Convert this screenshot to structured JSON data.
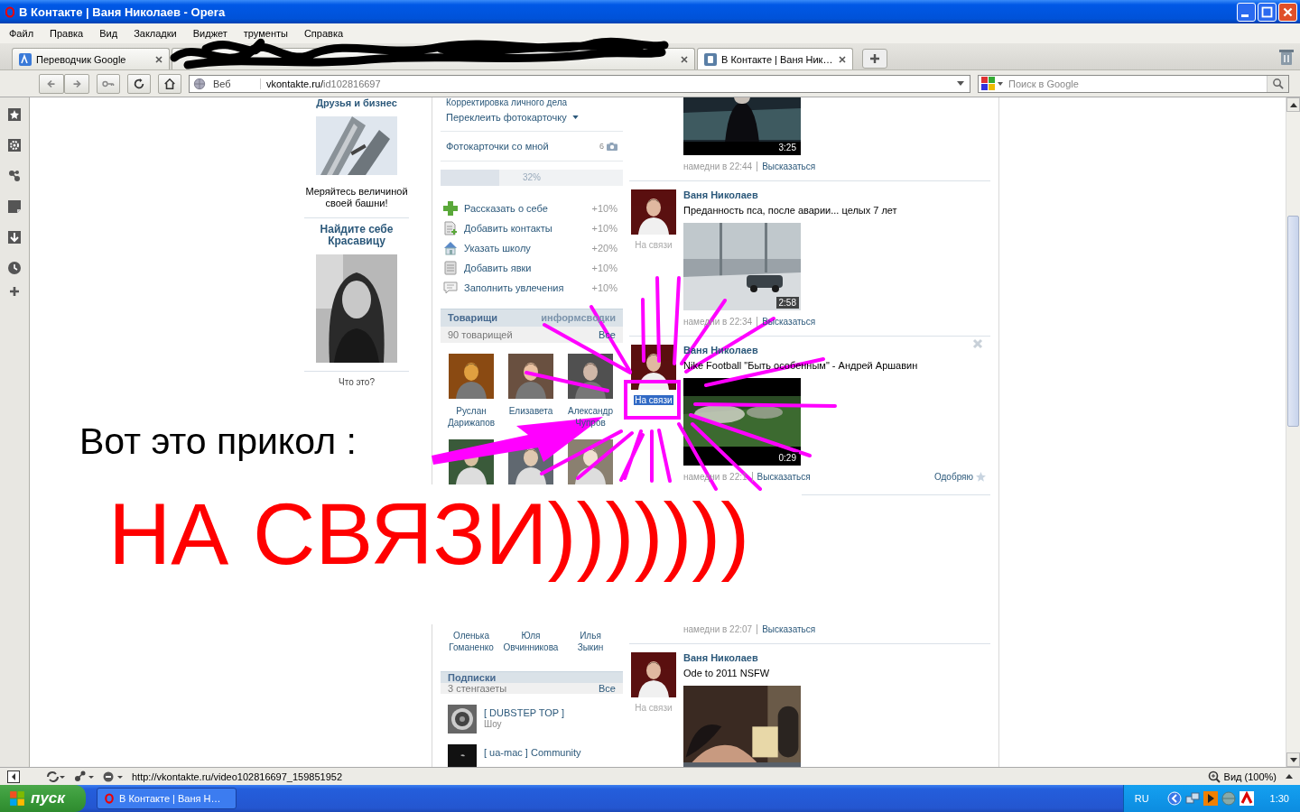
{
  "window": {
    "title": "В Контакте | Ваня Николаев - Opera"
  },
  "menu": [
    "Файл",
    "Правка",
    "Вид",
    "Закладки",
    "Виджет",
    "трументы",
    "Справка"
  ],
  "tabs": [
    {
      "title": "Переводчик Google",
      "selected": false,
      "redacted": false
    },
    {
      "selected": false,
      "redacted": true
    },
    {
      "title": "В Контакте | Ваня Ник…",
      "selected": true,
      "redacted": false
    }
  ],
  "address": {
    "label": "Веб",
    "host": "vkontakte.ru/",
    "path": "id102816697"
  },
  "search": {
    "placeholder": "Поиск в Google"
  },
  "ads": [
    {
      "title": "Друзья и бизнес",
      "kind": "towers",
      "text": "Меряйтесь величиной своей башни!"
    },
    {
      "title": "Найдите себе Красавицу",
      "kind": "portrait"
    }
  ],
  "ads_link": "Что это?",
  "profile_menu": {
    "cut_item": "Корректировка личного дела",
    "photo_action": "Переклеить фотокарточку",
    "photos_with_me": "Фотокарточки со мной",
    "photos_count": "6"
  },
  "completion": {
    "level": 0.32,
    "reading": "32%",
    "items": [
      {
        "kind": "plus",
        "label": "Рассказать о себе",
        "bonus": "+10%"
      },
      {
        "kind": "contacts",
        "label": "Добавить контакты",
        "bonus": "+10%"
      },
      {
        "kind": "school",
        "label": "Указать школу",
        "bonus": "+20%"
      },
      {
        "kind": "phone",
        "label": "Добавить явки",
        "bonus": "+10%"
      },
      {
        "kind": "hobby",
        "label": "Заполнить увлечения",
        "bonus": "+10%"
      }
    ]
  },
  "friends": {
    "title": "Товарищи",
    "tab": "информсводки",
    "count": "90 товарищей",
    "all": "Все",
    "people": [
      {
        "first": "Руслан",
        "last": "Дарижапов"
      },
      {
        "first": "Елизавета"
      },
      {
        "first": "Александр",
        "last": "Чупров"
      },
      {
        "first": "Оленька",
        "last": "Гоманенко"
      },
      {
        "first": "Юля",
        "last": "Овчинникова"
      },
      {
        "first": "Илья",
        "last": "Зыкин"
      }
    ]
  },
  "subscriptions": {
    "title": "Подписки",
    "count": "3 стенгазеты",
    "all": "Все",
    "items": [
      {
        "kind": "speaker",
        "name": "[ DUBSTEP TOP ]",
        "category": "Шоу"
      },
      {
        "kind": "dark",
        "name": "[ ua-mac ] Community"
      }
    ]
  },
  "feed_top": [
    {
      "partial": true,
      "duration": "3:25",
      "time": "намедни в 22:44",
      "reply": "Высказаться"
    },
    {
      "author": "Ваня Николаев",
      "status": "На связи",
      "status_selected": false,
      "text": "Преданность пса, после аварии... целых 7 лет",
      "duration": "2:58",
      "time": "намедни в 22:34",
      "reply": "Высказаться"
    },
    {
      "author": "Ваня Николаев",
      "status": "На связи",
      "status_selected": true,
      "text": "Nike Football \"Быть особенным\" - Андрей Аршавин",
      "duration": "0:29",
      "time": "намедни в 22:1",
      "reply": "Высказаться",
      "like": "Одобряю",
      "closable": true
    }
  ],
  "feed_bottom": [
    {
      "time": "намедни в 22:07",
      "reply": "Высказаться"
    },
    {
      "author": "Ваня Николаев",
      "status": "На связи",
      "status_selected": false,
      "text": "Ode to 2011 NSFW"
    }
  ],
  "annotation": {
    "caption": "Вот это прикол :",
    "shout": "НА СВЯЗИ)))))))"
  },
  "status_bar": {
    "url": "http://vkontakte.ru/video102816697_159851952",
    "zoom": "Вид (100%)"
  },
  "taskbar": {
    "start": "пуск",
    "tasks": [
      {
        "title": "В Контакте | Ваня Н…",
        "selected": false
      }
    ],
    "lang": "RU",
    "clock": "1:30"
  }
}
